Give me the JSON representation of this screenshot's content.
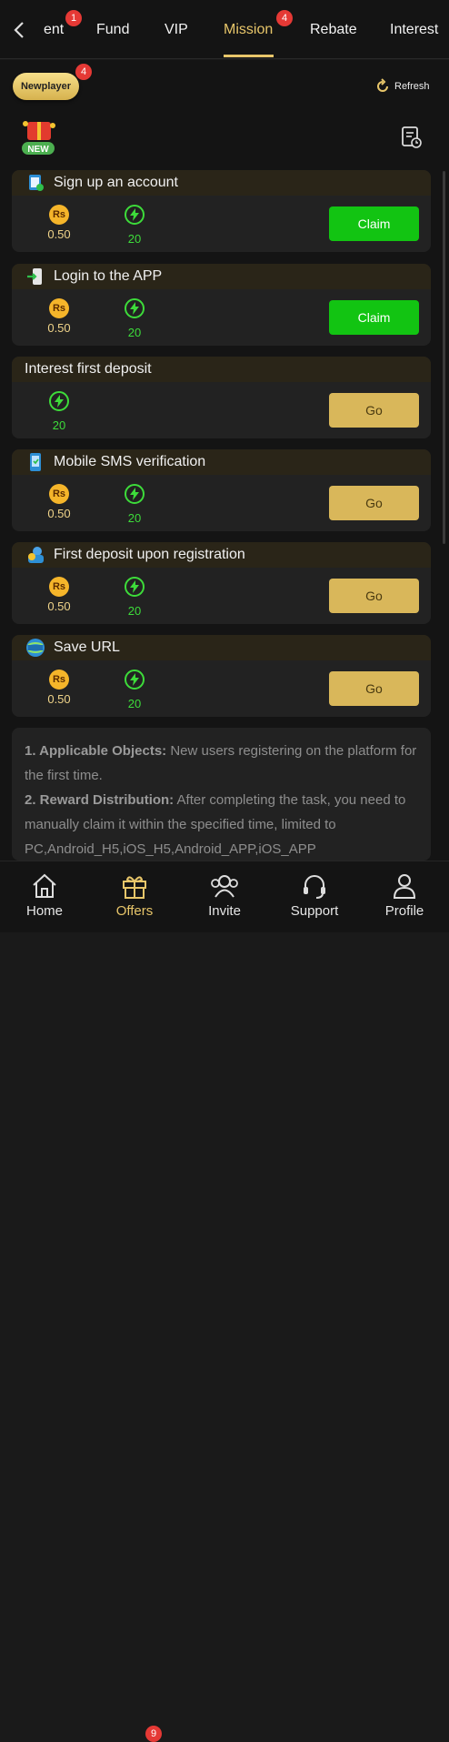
{
  "top_tabs": [
    {
      "label": "ent",
      "badge": "1"
    },
    {
      "label": "Fund"
    },
    {
      "label": "VIP"
    },
    {
      "label": "Mission",
      "badge": "4",
      "active": true
    },
    {
      "label": "Rebate"
    },
    {
      "label": "Interest"
    }
  ],
  "newplayer": {
    "label": "Newplayer",
    "badge": "4"
  },
  "new_icon_text": "NEW",
  "refresh_label": "Refresh",
  "currency_symbol": "Rs",
  "tasks": [
    {
      "title": "Sign up an account",
      "amount": "0.50",
      "points": "20",
      "button": "Claim"
    },
    {
      "title": "Login to the APP",
      "amount": "0.50",
      "points": "20",
      "button": "Claim"
    },
    {
      "title": "Interest first deposit",
      "points": "20",
      "button": "Go"
    },
    {
      "title": "Mobile SMS verification",
      "amount": "0.50",
      "points": "20",
      "button": "Go"
    },
    {
      "title": "First deposit upon registration",
      "amount": "0.50",
      "points": "20",
      "button": "Go"
    },
    {
      "title": "Save URL",
      "amount": "0.50",
      "points": "20",
      "button": "Go"
    }
  ],
  "rules": {
    "item1_head": "1. Applicable Objects:",
    "item1_text": " New users registering on the platform for the first time.",
    "item2_head": "2. Reward Distribution:",
    "item2_text": " After completing the task, you need to manually claim it within the specified time, limited to PC,Android_H5,iOS_H5,Android_APP,iOS_APP"
  },
  "bottom_nav": [
    {
      "label": "Home",
      "icon": "home-icon"
    },
    {
      "label": "Offers",
      "icon": "gift-icon",
      "badge": "9",
      "active": true
    },
    {
      "label": "Invite",
      "icon": "invite-icon"
    },
    {
      "label": "Support",
      "icon": "headset-icon"
    },
    {
      "label": "Profile",
      "icon": "profile-icon"
    }
  ],
  "colors": {
    "accent": "#e8c66a",
    "claim": "#12c412",
    "go": "#d9b75a",
    "points": "#3ddc3a",
    "badge": "#e53935"
  }
}
